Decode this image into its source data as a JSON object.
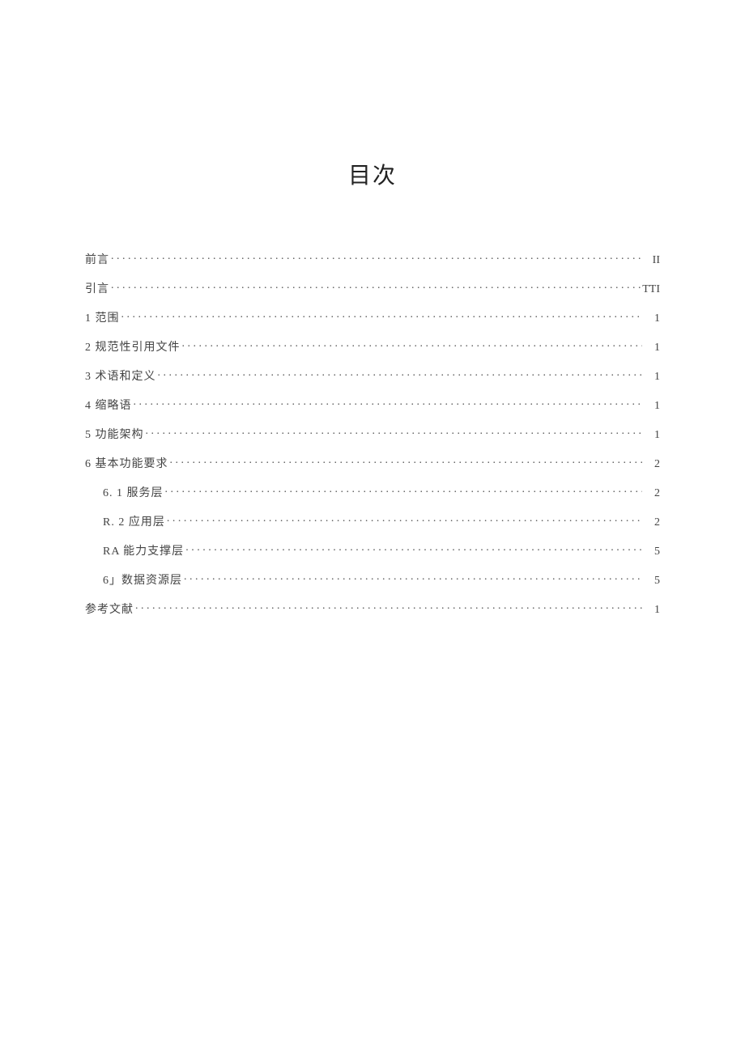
{
  "title": "目次",
  "toc": [
    {
      "label": "前言",
      "page": "II",
      "indent": false
    },
    {
      "label": "引言",
      "page": "TTI",
      "indent": false
    },
    {
      "label": "1 范围",
      "page": "1",
      "indent": false
    },
    {
      "label": "2 规范性引用文件",
      "page": "1",
      "indent": false
    },
    {
      "label": "3 术语和定义",
      "page": "1",
      "indent": false
    },
    {
      "label": "4 缩略语",
      "page": "1",
      "indent": false
    },
    {
      "label": "5 功能架构",
      "page": "1",
      "indent": false
    },
    {
      "label": "6 基本功能要求",
      "page": "2",
      "indent": false
    },
    {
      "label": "6. 1 服务层",
      "page": "2",
      "indent": true
    },
    {
      "label": "R. 2 应用层",
      "page": "2",
      "indent": true
    },
    {
      "label": "RA 能力支撑层",
      "page": "5",
      "indent": true
    },
    {
      "label": "6」数据资源层",
      "page": "5",
      "indent": true
    },
    {
      "label": "参考文献",
      "page": "1",
      "indent": false
    }
  ]
}
